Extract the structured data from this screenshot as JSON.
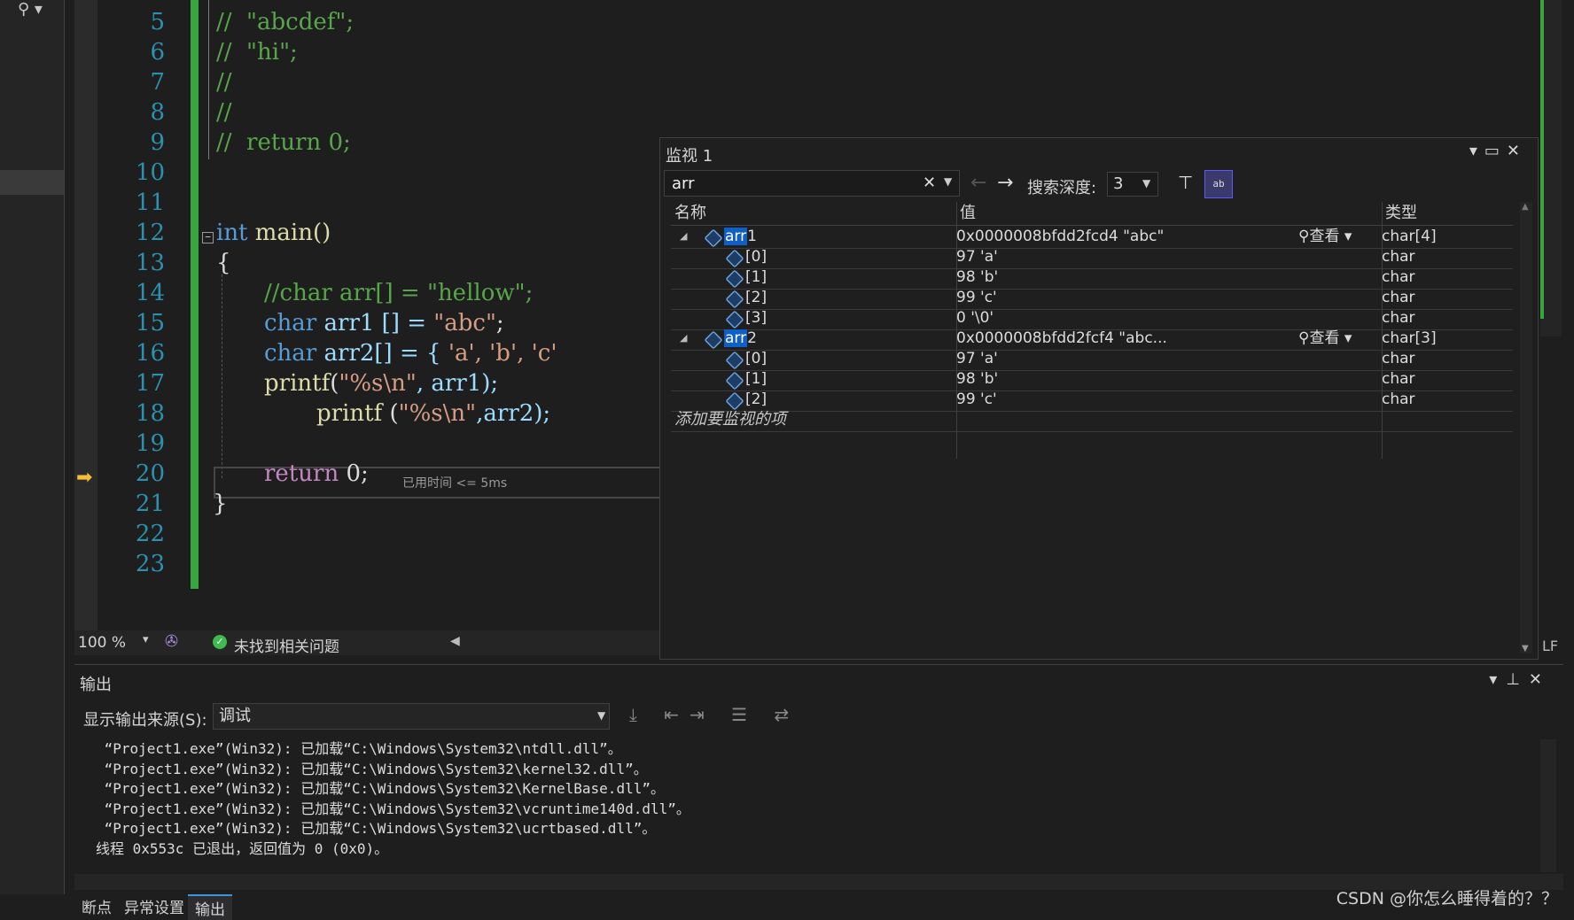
{
  "editor": {
    "line_numbers": [
      "5",
      "6",
      "7",
      "8",
      "9",
      "10",
      "11",
      "12",
      "13",
      "14",
      "15",
      "16",
      "17",
      "18",
      "19",
      "20",
      "21",
      "22",
      "23"
    ],
    "code_lines": {
      "l5": "//  \"abcdef\";",
      "l6": "//  \"hi\";",
      "l7": "//",
      "l8": "//",
      "l9": "//  return 0;",
      "l12a": "int",
      "l12b": " main()",
      "l13": "{",
      "l14": "//char arr[] = \"hellow\";",
      "l15a": "char",
      "l15b": " arr1 [] = ",
      "l15c": "\"abc\"",
      "l15d": ";",
      "l16a": "char",
      "l16b": " arr2[] = { ",
      "l16c": "'a', 'b', 'c'",
      "l17a": "printf",
      "l17b": "(",
      "l17c": "\"%s\\n\"",
      "l17d": ", arr1);",
      "l18a": "printf",
      "l18b": " (",
      "l18c": "\"%s\\n\"",
      "l18d": ",arr2);",
      "l20a": "return",
      "l20b": " 0;",
      "l21": "}"
    },
    "perf_tip": "已用时间 <= 5ms"
  },
  "editor_status": {
    "zoom": "100 %",
    "issues": "未找到相关问题"
  },
  "watch": {
    "title": "监视 1",
    "search_value": "arr",
    "depth_label": "搜索深度:",
    "depth_value": "3",
    "columns": {
      "name": "名称",
      "value": "值",
      "type": "类型"
    },
    "view_label": "查看",
    "rows": [
      {
        "name_hl": "arr",
        "name_rest": "1",
        "value": "0x0000008bfdd2fcd4 \"abc\"",
        "type": "char[4]"
      },
      {
        "name": "[0]",
        "value": "97 'a'",
        "type": "char"
      },
      {
        "name": "[1]",
        "value": "98 'b'",
        "type": "char"
      },
      {
        "name": "[2]",
        "value": "99 'c'",
        "type": "char"
      },
      {
        "name": "[3]",
        "value": "0 '\\0'",
        "type": "char"
      },
      {
        "name_hl": "arr",
        "name_rest": "2",
        "value": "0x0000008bfdd2fcf4 \"abc...",
        "type": "char[3]"
      },
      {
        "name": "[0]",
        "value": "97 'a'",
        "type": "char"
      },
      {
        "name": "[1]",
        "value": "98 'b'",
        "type": "char"
      },
      {
        "name": "[2]",
        "value": "99 'c'",
        "type": "char"
      }
    ],
    "add_item": "添加要监视的项"
  },
  "output": {
    "title": "输出",
    "source_label": "显示输出来源(S):",
    "source_value": "调试",
    "lines": [
      " “Project1.exe”(Win32): 已加载“C:\\Windows\\System32\\ntdll.dll”。",
      " “Project1.exe”(Win32): 已加载“C:\\Windows\\System32\\kernel32.dll”。",
      " “Project1.exe”(Win32): 已加载“C:\\Windows\\System32\\KernelBase.dll”。",
      " “Project1.exe”(Win32): 已加载“C:\\Windows\\System32\\vcruntime140d.dll”。",
      " “Project1.exe”(Win32): 已加载“C:\\Windows\\System32\\ucrtbased.dll”。",
      "线程 0x553c 已退出，返回值为 0 (0x0)。"
    ]
  },
  "bottom_tabs": [
    "断点",
    "异常设置",
    "输出"
  ],
  "line_ending": "LF",
  "watermark": "CSDN @你怎么睡得着的？？",
  "colors": {
    "accent": "#3a96dd",
    "change_bar": "#37a63e",
    "highlight": "#0e5fc8"
  }
}
